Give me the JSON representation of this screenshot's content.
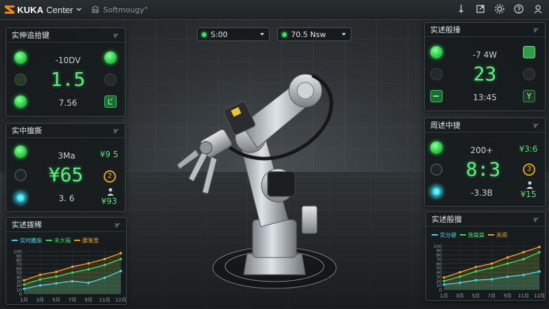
{
  "app": {
    "brand": "KUKA",
    "product": "Center",
    "breadcrumb": "Softmougy°"
  },
  "toolbar": {
    "icons": [
      "pin-icon",
      "export-icon",
      "settings-icon",
      "help-icon",
      "user-icon"
    ]
  },
  "dropdowns": [
    {
      "value": "S:00",
      "status_color": "#3ddc5f"
    },
    {
      "value": "70.5 Nsw",
      "status_color": "#3ddc5f"
    }
  ],
  "left_panels": [
    {
      "title": "实伸追拾键",
      "top_value": "-10DV",
      "big_value": "1.5",
      "bottom_value": "7.56"
    },
    {
      "title": "实中擅撕",
      "top_value": "3Ma",
      "right_top": "¥9 5",
      "big_value": "¥65",
      "bottom_value": "3. 6",
      "right_bottom": "¥93",
      "badge": "2"
    }
  ],
  "right_panels": [
    {
      "title": "实述般捶",
      "top_value": "-7 4W",
      "big_value": "23",
      "bottom_value": "13:45"
    },
    {
      "title": "周述中捷",
      "top_value": "200+",
      "right_top": "¥3:6",
      "big_value": "8:3",
      "bottom_value": "-3.3B",
      "right_bottom": "¥15",
      "badge": "3"
    }
  ],
  "colors": {
    "green": "#3ddc5f",
    "orange": "#f0a12c",
    "cyan": "#4fd3e8",
    "accent_text": "#5cf07c"
  },
  "chart_data": [
    {
      "type": "line",
      "title": "实述拨稀",
      "legend": [
        "实时撒施",
        "未大福",
        "腰笺里"
      ],
      "x": [
        "1月",
        "3月",
        "5月",
        "7月",
        "9月",
        "11月",
        "12月"
      ],
      "y_ticks": [
        0,
        10,
        20,
        30,
        40,
        50,
        60,
        70,
        80,
        90,
        100
      ],
      "ylim": [
        0,
        110
      ],
      "series": [
        {
          "name": "腰笺里",
          "color": "#f0a12c",
          "values": [
            32,
            45,
            52,
            64,
            72,
            82,
            96
          ]
        },
        {
          "name": "未大福",
          "color": "#3ddc5f",
          "values": [
            22,
            34,
            41,
            50,
            58,
            68,
            82
          ]
        },
        {
          "name": "实时撒施",
          "color": "#4fd3e8",
          "values": [
            12,
            20,
            25,
            30,
            26,
            38,
            54
          ]
        }
      ]
    },
    {
      "type": "line",
      "title": "实述般擅",
      "legend": [
        "实分避",
        "施篇篇",
        "关闹"
      ],
      "x": [
        "1月",
        "3月",
        "5月",
        "7月",
        "9月",
        "11月",
        "12月"
      ],
      "y_ticks": [
        0,
        10,
        20,
        30,
        40,
        50,
        60,
        70,
        80,
        90,
        100
      ],
      "ylim": [
        0,
        110
      ],
      "series": [
        {
          "name": "关闹",
          "color": "#f0a12c",
          "values": [
            28,
            40,
            52,
            60,
            74,
            86,
            98
          ]
        },
        {
          "name": "施篇篇",
          "color": "#3ddc5f",
          "values": [
            20,
            30,
            42,
            50,
            60,
            70,
            86
          ]
        },
        {
          "name": "实分避",
          "color": "#4fd3e8",
          "values": [
            12,
            16,
            22,
            24,
            30,
            34,
            42
          ]
        }
      ]
    }
  ]
}
